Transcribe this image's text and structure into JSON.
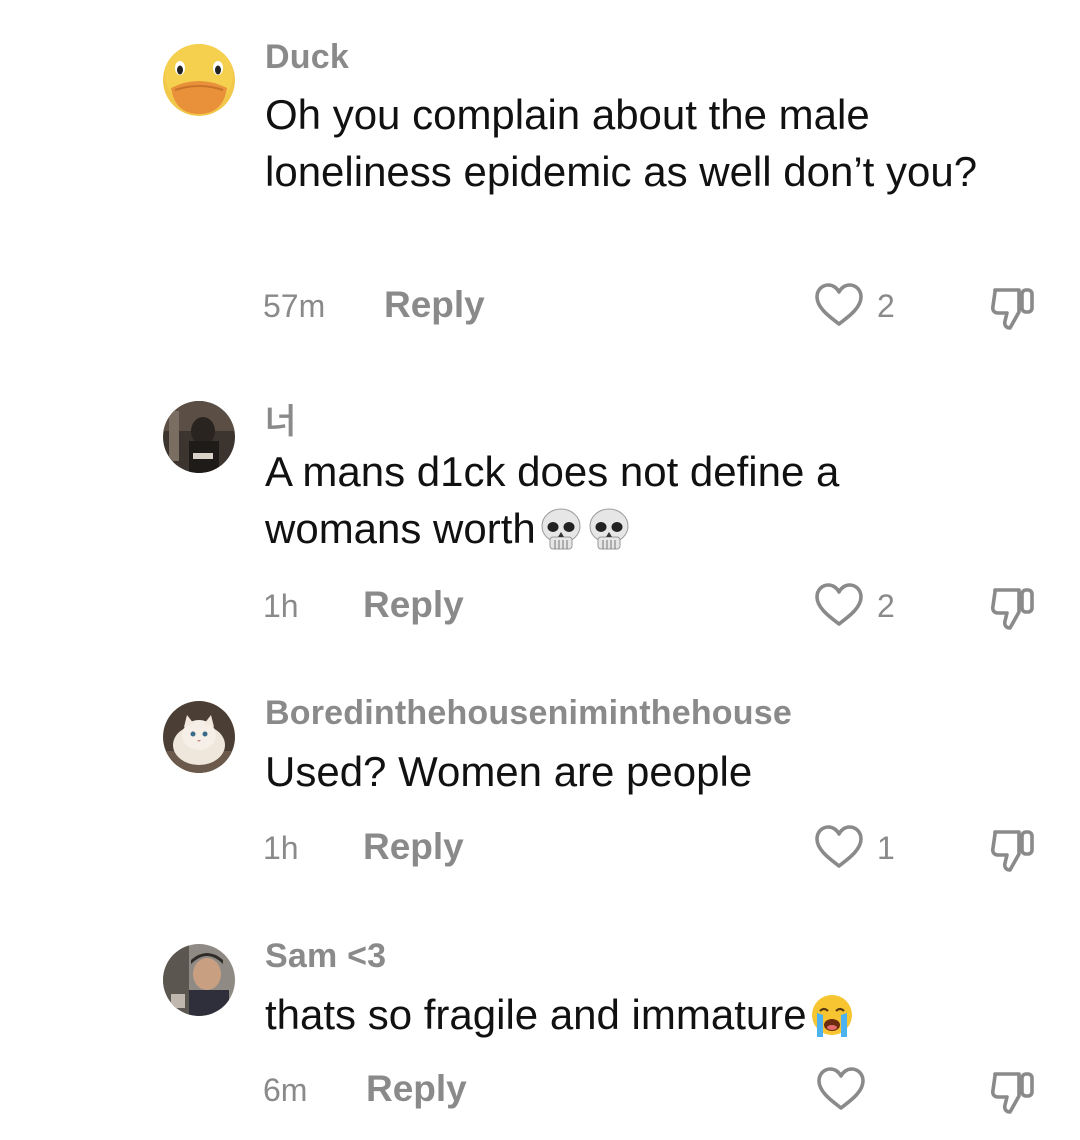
{
  "comments": [
    {
      "username": "Duck",
      "text": "Oh you complain about the male loneliness epidemic as well don’t you?",
      "time": "57m",
      "reply_label": "Reply",
      "likes": "2",
      "emoji": []
    },
    {
      "username": "너",
      "text": "A mans d1ck does not define a womans worth",
      "time": "1h",
      "reply_label": "Reply",
      "likes": "2",
      "emoji": [
        "skull-emoji",
        "skull-emoji"
      ]
    },
    {
      "username": "Boredinthehouseniminthehouse",
      "text": "Used? Women are people",
      "time": "1h",
      "reply_label": "Reply",
      "likes": "1",
      "emoji": []
    },
    {
      "username": "Sam <3",
      "text": "thats so fragile and immature",
      "time": "6m",
      "reply_label": "Reply",
      "likes": "",
      "emoji": [
        "loudly-crying-emoji"
      ]
    }
  ],
  "icons": {
    "like": "heart-outline-icon",
    "dislike": "thumbs-down-icon"
  },
  "colors": {
    "secondary_text": "#8a8a8a",
    "primary_text": "#111111",
    "background": "#ffffff"
  }
}
